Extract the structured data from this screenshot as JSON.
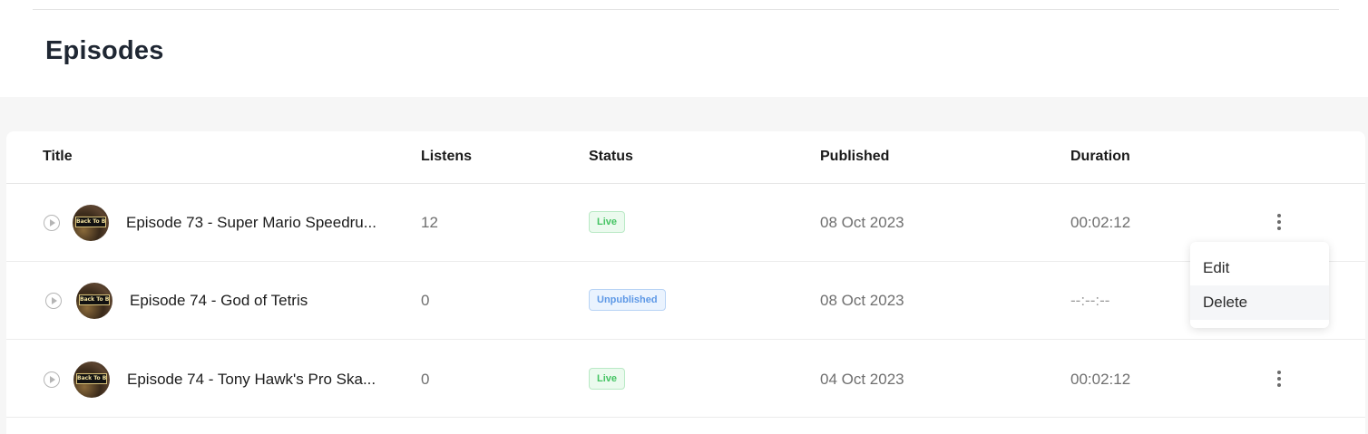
{
  "page": {
    "title": "Episodes"
  },
  "table": {
    "columns": [
      "Title",
      "Listens",
      "Status",
      "Published",
      "Duration"
    ],
    "thumbnail_text": "Back To Bits",
    "rows": [
      {
        "title": "Episode 73 - Super Mario Speedru...",
        "listens": "12",
        "status": "Live",
        "published": "08 Oct 2023",
        "duration": "00:02:12"
      },
      {
        "title": "Episode 74 - God of Tetris",
        "listens": "0",
        "status": "Unpublished",
        "published": "08 Oct 2023",
        "duration": "--:--:--"
      },
      {
        "title": "Episode 74 - Tony Hawk's Pro Ska...",
        "listens": "0",
        "status": "Live",
        "published": "04 Oct 2023",
        "duration": "00:02:12"
      }
    ]
  },
  "context_menu": {
    "items": [
      "Edit",
      "Delete"
    ]
  },
  "colors": {
    "live": "#45c463",
    "unpublished": "#5d98e6",
    "title": "#1f2733"
  }
}
